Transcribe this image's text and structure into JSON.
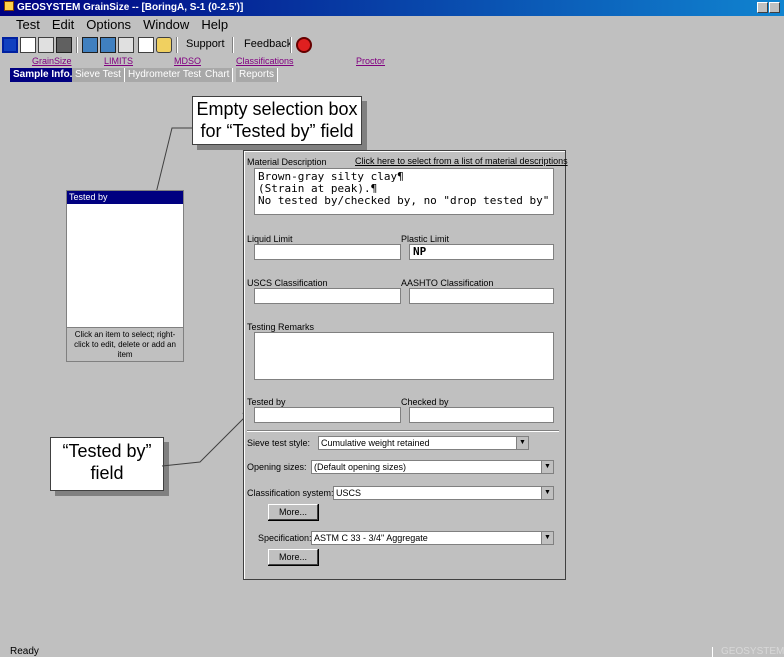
{
  "window": {
    "title": "GEOSYSTEM GrainSize -- [BoringA, S-1 (0-2.5')]"
  },
  "menu": [
    "Test",
    "Edit",
    "Options",
    "Window",
    "Help"
  ],
  "toolbar": {
    "support": "Support",
    "feedback": "Feedback"
  },
  "links": [
    "GrainSize",
    "LIMITS",
    "MDSO",
    "Classifications",
    "Proctor"
  ],
  "tabs": [
    "Sample Info.",
    "Sieve Test",
    "Hydrometer Test",
    "Chart",
    "Reports"
  ],
  "callouts": {
    "empty_box_line1": "Empty selection box",
    "empty_box_line2": "for “Tested by” field",
    "field_line1": "“Tested by”",
    "field_line2": "field"
  },
  "selection_box": {
    "header": "Tested by",
    "hint": "Click an item to select; right-click to edit, delete or add an item"
  },
  "form": {
    "material_label": "Material Description",
    "material_link": "Click here to select from a list of material descriptions",
    "material_lines": [
      "Brown-gray silty clay¶",
      "(Strain at peak).¶",
      "No tested by/checked by, no \"drop tested by\""
    ],
    "liquid_limit_label": "Liquid Limit",
    "liquid_limit_value": "",
    "plastic_limit_label": "Plastic Limit",
    "plastic_limit_value": "NP",
    "uscs_label": "USCS Classification",
    "aashto_label": "AASHTO Classification",
    "remarks_label": "Testing Remarks",
    "tested_by_label": "Tested by",
    "checked_by_label": "Checked by",
    "sieve_style_label": "Sieve test style:",
    "sieve_style_value": "Cumulative weight retained",
    "opening_label": "Opening sizes:",
    "opening_value": "(Default opening sizes)",
    "class_system_label": "Classification system:",
    "class_system_value": "USCS",
    "more1": "More...",
    "spec_label": "Specification:",
    "spec_value": "ASTM C 33 - 3/4\" Aggregate",
    "more2": "More..."
  },
  "status": {
    "text": "Ready",
    "brand": "GEOSYSTEM"
  },
  "colors": {
    "titlebar": "#000080",
    "active_tab": "#000080",
    "link": "#800080"
  }
}
